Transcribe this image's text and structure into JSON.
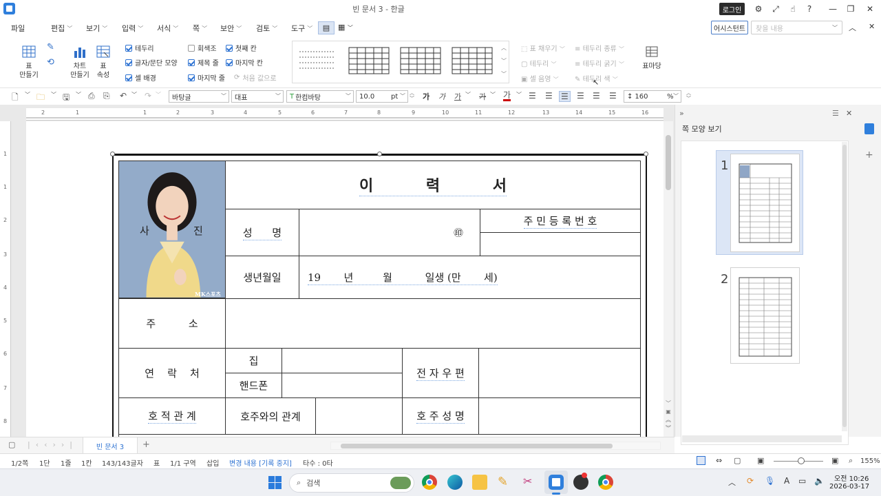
{
  "window": {
    "title": "빈 문서 3 - 한글",
    "login": "로그인"
  },
  "menu": {
    "items": [
      "파일",
      "편집",
      "보기",
      "입력",
      "서식",
      "쪽",
      "보안",
      "검토",
      "도구"
    ],
    "assistant": "어시스턴트",
    "search_placeholder": "찾을 내용"
  },
  "ribbon": {
    "table_make": "표\n만들기",
    "chart_make": "차트\n만들기",
    "table_props": "표\n속성",
    "checks": [
      {
        "label": "테두리",
        "checked": true
      },
      {
        "label": "글자/문단 모양",
        "checked": true
      },
      {
        "label": "셀 배경",
        "checked": true
      },
      {
        "label": "회색조",
        "checked": false
      },
      {
        "label": "제목 줄",
        "checked": true
      },
      {
        "label": "마지막 줄",
        "checked": true
      },
      {
        "label": "첫째 칸",
        "checked": true
      },
      {
        "label": "마지막 칸",
        "checked": true
      }
    ],
    "reset_label": "처음 값으로",
    "cell_tools": [
      "표 채우기",
      "테두리",
      "셀 음영",
      "테두리 종류",
      "테두리 굵기",
      "테두리 색"
    ],
    "page_label": "표마당"
  },
  "format": {
    "style": "바탕글",
    "lang": "대표",
    "font": "한컴바탕",
    "size": "10.0",
    "unit": "pt",
    "line_spacing": "160",
    "pct": "%",
    "bold": "가",
    "italic": "가",
    "underline": "가",
    "strike": "가"
  },
  "document": {
    "title": "이          력          서",
    "photo_label_left": "사",
    "photo_label_right": "진",
    "photo_watermark": "MK스포츠",
    "name_label": "성      명",
    "seal": "㊞",
    "rrn_label": "주 민 등 록 번 호",
    "birth_label": "생년월일",
    "birth_value": "19       년         월          일생 (만       세)",
    "address_label": "주          소",
    "contact_label": "연    락    처",
    "home": "집",
    "mobile": "핸드폰",
    "email_label": "전 자 우 편",
    "family_label": "호 적 관 계",
    "relation_label": "호주와의 관계",
    "head_label": "호 주 성 명"
  },
  "right_panel": {
    "title": "쪽 모양 보기",
    "pages": [
      "1",
      "2"
    ]
  },
  "tabs": {
    "doc": "빈 문서 3",
    "add": "+"
  },
  "status": {
    "page": "1/2쪽",
    "dan": "1단",
    "line": "1줄",
    "col": "1칸",
    "chars": "143/143글자",
    "mark": "표",
    "section": "1/1 구역",
    "mode": "삽입",
    "track": "변경 내용 [기록 중지]",
    "count": "타수 : 0타",
    "zoom": "155%"
  },
  "taskbar": {
    "search": "검색",
    "time": "오전 10:26",
    "date": "2026-03-17"
  }
}
